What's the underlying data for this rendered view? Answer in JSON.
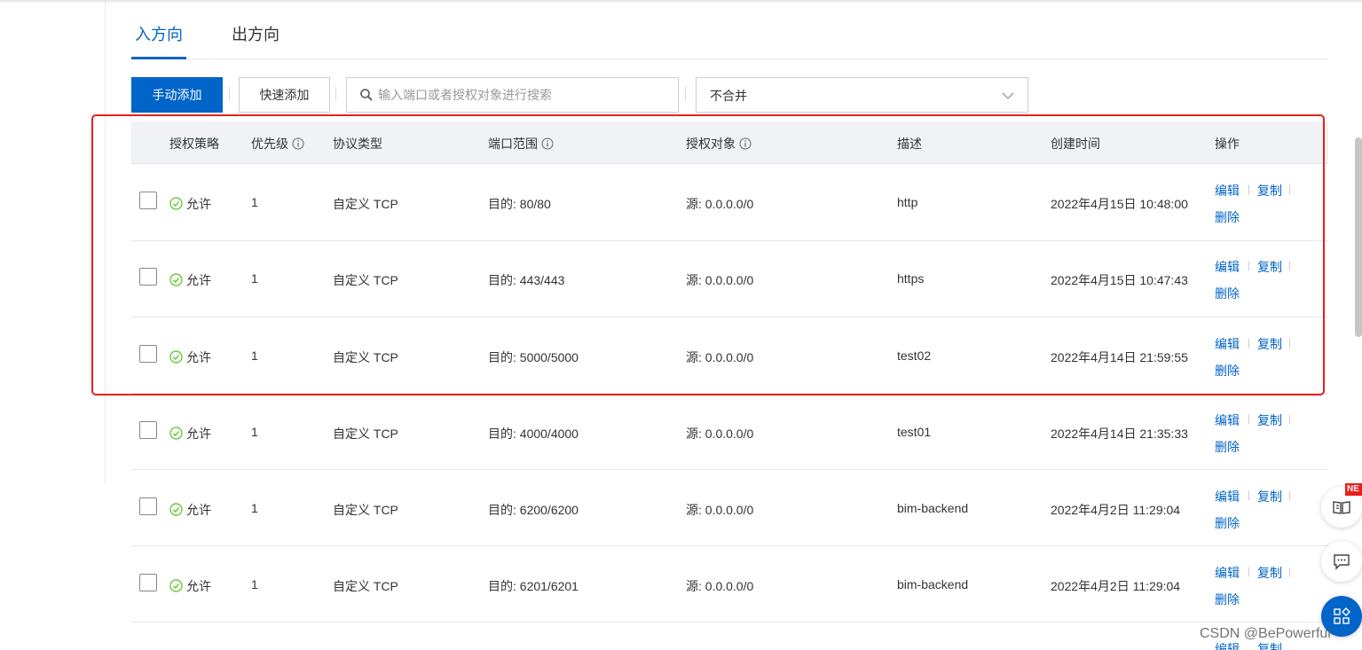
{
  "tabs": {
    "inbound": "入方向",
    "outbound": "出方向"
  },
  "toolbar": {
    "manual_add": "手动添加",
    "quick_add": "快速添加",
    "search_placeholder": "输入端口或者授权对象进行搜索",
    "merge_select_value": "不合并"
  },
  "table": {
    "headers": {
      "policy": "授权策略",
      "priority": "优先级",
      "protocol": "协议类型",
      "port_range": "端口范围",
      "auth_object": "授权对象",
      "description": "描述",
      "created": "创建时间",
      "actions": "操作"
    },
    "action_labels": {
      "edit": "编辑",
      "copy": "复制",
      "delete": "删除"
    },
    "rows": [
      {
        "policy": "允许",
        "priority": "1",
        "protocol": "自定义 TCP",
        "port": "目的: 80/80",
        "source": "源: 0.0.0.0/0",
        "desc": "http",
        "created": "2022年4月15日 10:48:00"
      },
      {
        "policy": "允许",
        "priority": "1",
        "protocol": "自定义 TCP",
        "port": "目的: 443/443",
        "source": "源: 0.0.0.0/0",
        "desc": "https",
        "created": "2022年4月15日 10:47:43"
      },
      {
        "policy": "允许",
        "priority": "1",
        "protocol": "自定义 TCP",
        "port": "目的: 5000/5000",
        "source": "源: 0.0.0.0/0",
        "desc": "test02",
        "created": "2022年4月14日 21:59:55"
      },
      {
        "policy": "允许",
        "priority": "1",
        "protocol": "自定义 TCP",
        "port": "目的: 4000/4000",
        "source": "源: 0.0.0.0/0",
        "desc": "test01",
        "created": "2022年4月14日 21:35:33"
      },
      {
        "policy": "允许",
        "priority": "1",
        "protocol": "自定义 TCP",
        "port": "目的: 6200/6200",
        "source": "源: 0.0.0.0/0",
        "desc": "bim-backend",
        "created": "2022年4月2日 11:29:04"
      },
      {
        "policy": "允许",
        "priority": "1",
        "protocol": "自定义 TCP",
        "port": "目的: 6201/6201",
        "source": "源: 0.0.0.0/0",
        "desc": "bim-backend",
        "created": "2022年4月2日 11:29:04"
      }
    ],
    "partial_row_actions": {
      "edit": "编辑",
      "copy": "复制"
    }
  },
  "float": {
    "new_badge": "NE"
  },
  "watermark": "CSDN @BePowerful",
  "colors": {
    "primary": "#0064c8",
    "highlight": "#e8201c",
    "allow": "#52c41a"
  }
}
